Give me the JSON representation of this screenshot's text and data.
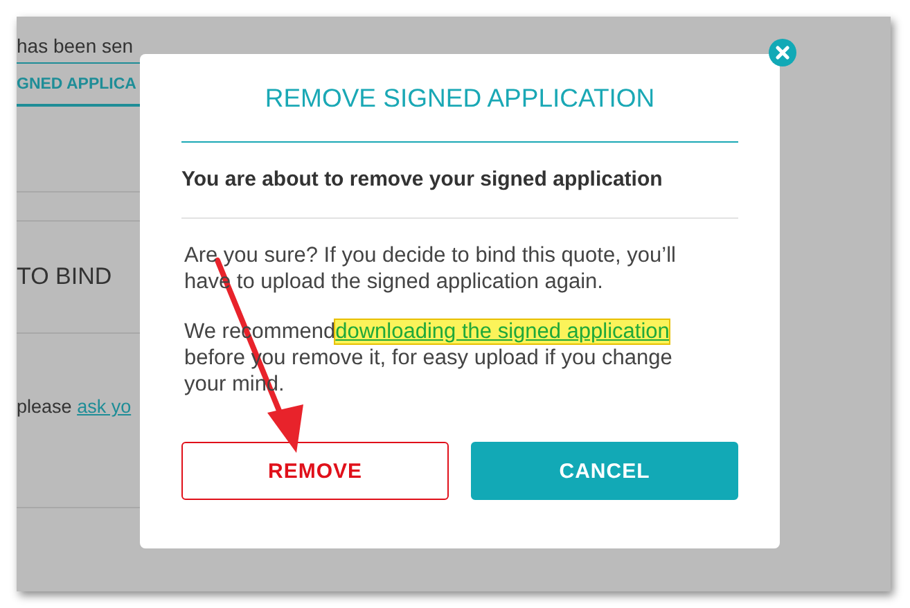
{
  "background": {
    "notice": "has been sen",
    "tab": "GNED APPLICA",
    "section_heading": "TO BIND",
    "prompt": "please",
    "prompt_link": "ask yo"
  },
  "dialog": {
    "title": "REMOVE SIGNED APPLICATION",
    "subtitle": "You are about to remove your signed application",
    "warning": "Are you sure? If you decide to bind this quote, you’ll have to upload the signed application again.",
    "recommendation_before": "We recommend",
    "recommendation_link": "downloading the signed application",
    "link_highlighted": true,
    "recommendation_after": "before you remove it, for easy upload if you change your mind.",
    "buttons": [
      {
        "label": "REMOVE",
        "kind": "danger"
      },
      {
        "label": "CANCEL",
        "kind": "primary"
      }
    ]
  }
}
